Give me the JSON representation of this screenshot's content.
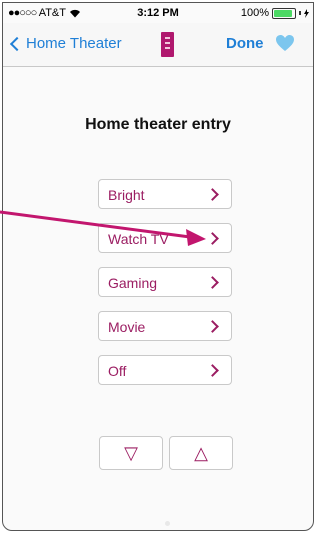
{
  "status_bar": {
    "signal": "●●○○○",
    "carrier": "AT&T",
    "time": "3:12 PM",
    "battery": "100%",
    "battery_level": 1.0
  },
  "nav": {
    "back_label": "Home Theater",
    "done_label": "Done"
  },
  "page": {
    "title": "Home theater entry"
  },
  "scenes": [
    {
      "label": "Bright"
    },
    {
      "label": "Watch TV"
    },
    {
      "label": "Gaming"
    },
    {
      "label": "Movie"
    },
    {
      "label": "Off"
    }
  ],
  "controls": {
    "down_glyph": "▽",
    "up_glyph": "△"
  },
  "colors": {
    "accent_blue": "#1f7fd6",
    "accent_magenta": "#9b1d62",
    "annotation_arrow": "#c2166e",
    "heart": "#7cc6ee"
  }
}
